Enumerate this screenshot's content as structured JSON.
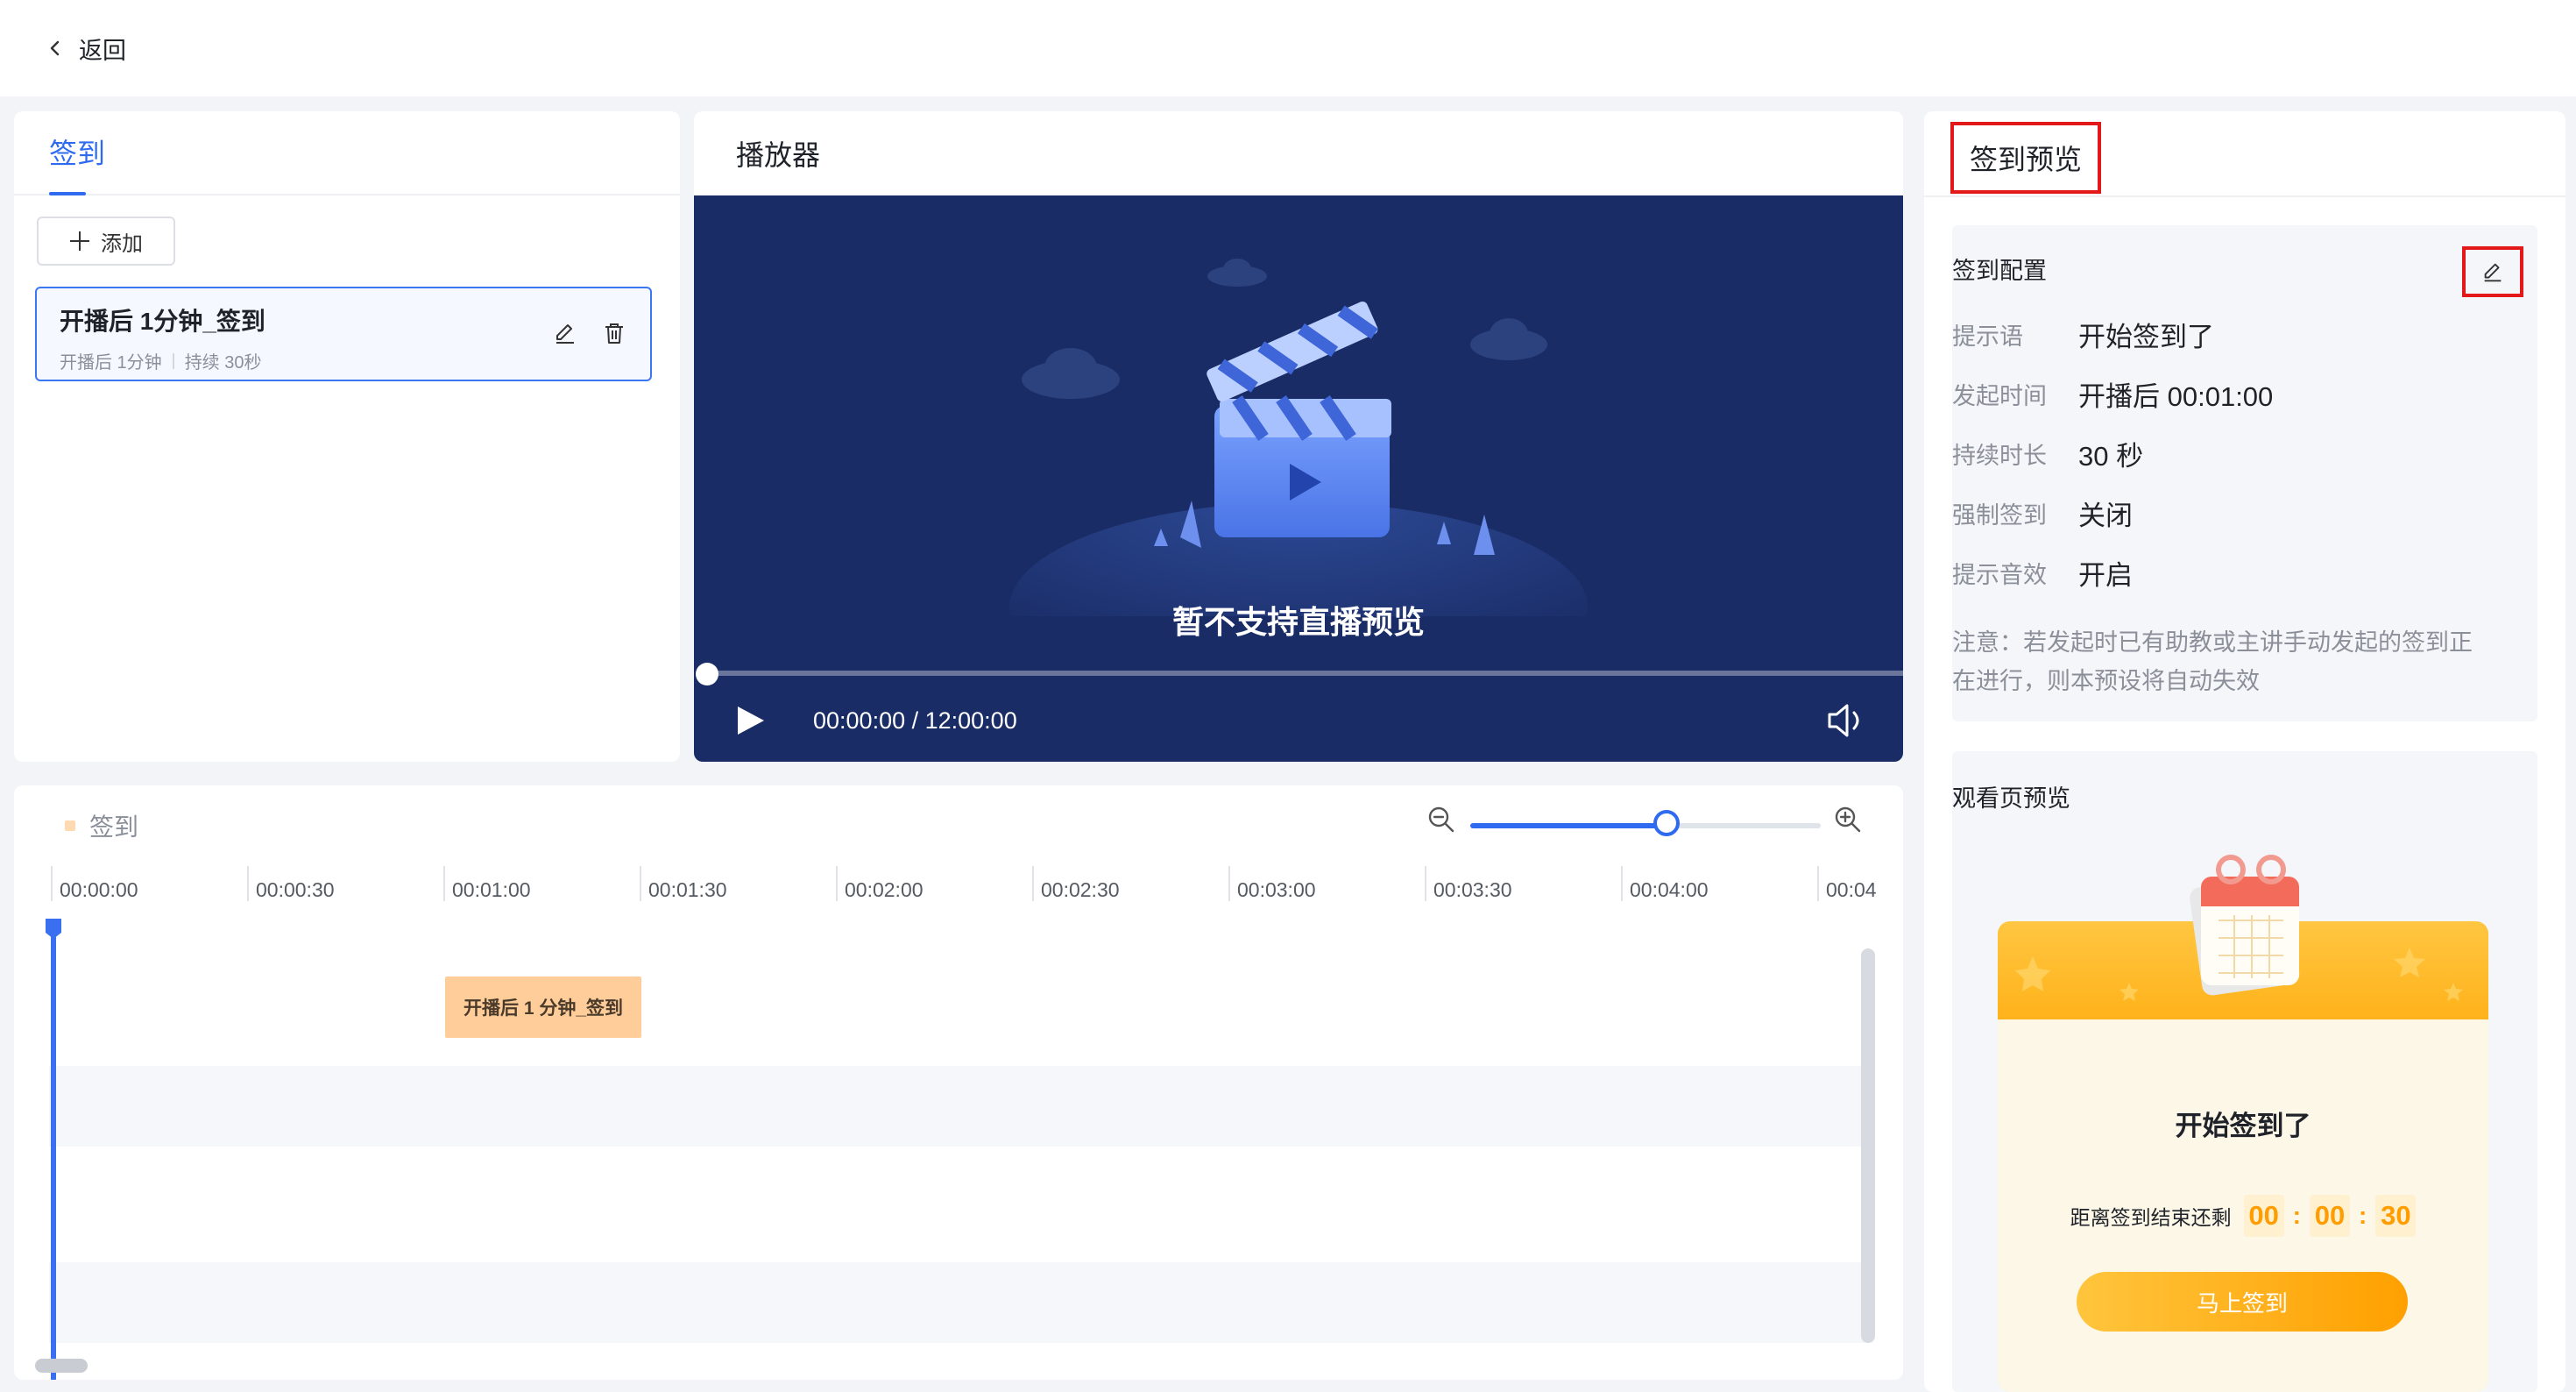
{
  "topbar": {
    "back_label": "返回"
  },
  "sign_panel": {
    "tab_label": "签到",
    "add_label": "添加",
    "item": {
      "title": "开播后 1分钟_签到",
      "meta_start": "开播后 1分钟",
      "meta_duration": "持续 30秒"
    }
  },
  "player": {
    "title": "播放器",
    "message": "暂不支持直播预览",
    "time": "00:00:00 / 12:00:00",
    "progress": 0
  },
  "timeline": {
    "legend_label": "签到",
    "zoom_level": 0.56,
    "ticks": [
      "00:00:00",
      "00:00:30",
      "00:01:00",
      "00:01:30",
      "00:02:00",
      "00:02:30",
      "00:03:00",
      "00:03:30",
      "00:04:00",
      "00:04"
    ],
    "event_label": "开播后 1 分钟_签到",
    "event_color": "#ffcd9a"
  },
  "preview_panel": {
    "title": "签到预览",
    "config_title": "签到配置",
    "config": [
      {
        "key": "提示语",
        "value": "开始签到了"
      },
      {
        "key": "发起时间",
        "value": "开播后 00:01:00"
      },
      {
        "key": "持续时长",
        "value": "30 秒"
      },
      {
        "key": "强制签到",
        "value": "关闭"
      },
      {
        "key": "提示音效",
        "value": "开启"
      }
    ],
    "note": "注意：若发起时已有助教或主讲手动发起的签到正在进行，则本预设将自动失效",
    "watch_title": "观看页预览",
    "watch": {
      "message": "开始签到了",
      "countdown_label": "距离签到结束还剩",
      "hh": "00",
      "mm": "00",
      "ss": "30",
      "button_label": "马上签到"
    }
  },
  "colors": {
    "accent": "#2f6bf0",
    "highlight_frame": "#e31818",
    "event_block": "#ffcd9a",
    "countdown": "#ff9c00"
  }
}
